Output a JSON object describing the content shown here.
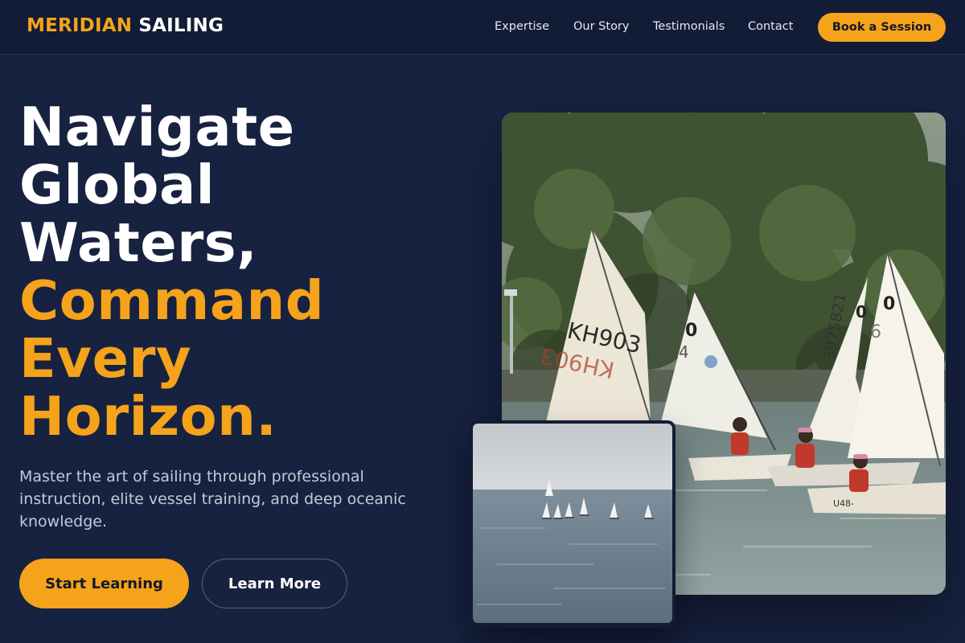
{
  "brand": {
    "part1": "MERIDIAN",
    "part2": "SAILING"
  },
  "nav": {
    "items": [
      "Expertise",
      "Our Story",
      "Testimonials",
      "Contact"
    ],
    "cta": "Book a Session"
  },
  "hero": {
    "headline_white": [
      "Navigate",
      "Global",
      "Waters,"
    ],
    "headline_gold": [
      "Command",
      "Every",
      "Horizon."
    ],
    "subtitle": "Master the art of sailing through professional instruction, elite vessel training, and deep oceanic knowledge.",
    "primary_cta": "Start Learning",
    "secondary_cta": "Learn More"
  },
  "images": {
    "main": {
      "sail_numbers": [
        "KH903",
        "0",
        "4",
        "0",
        "3975821",
        "6",
        "U48-"
      ]
    },
    "inset": {}
  },
  "colors": {
    "background": "#172240",
    "header": "#131c36",
    "accent": "#f5a31a"
  }
}
